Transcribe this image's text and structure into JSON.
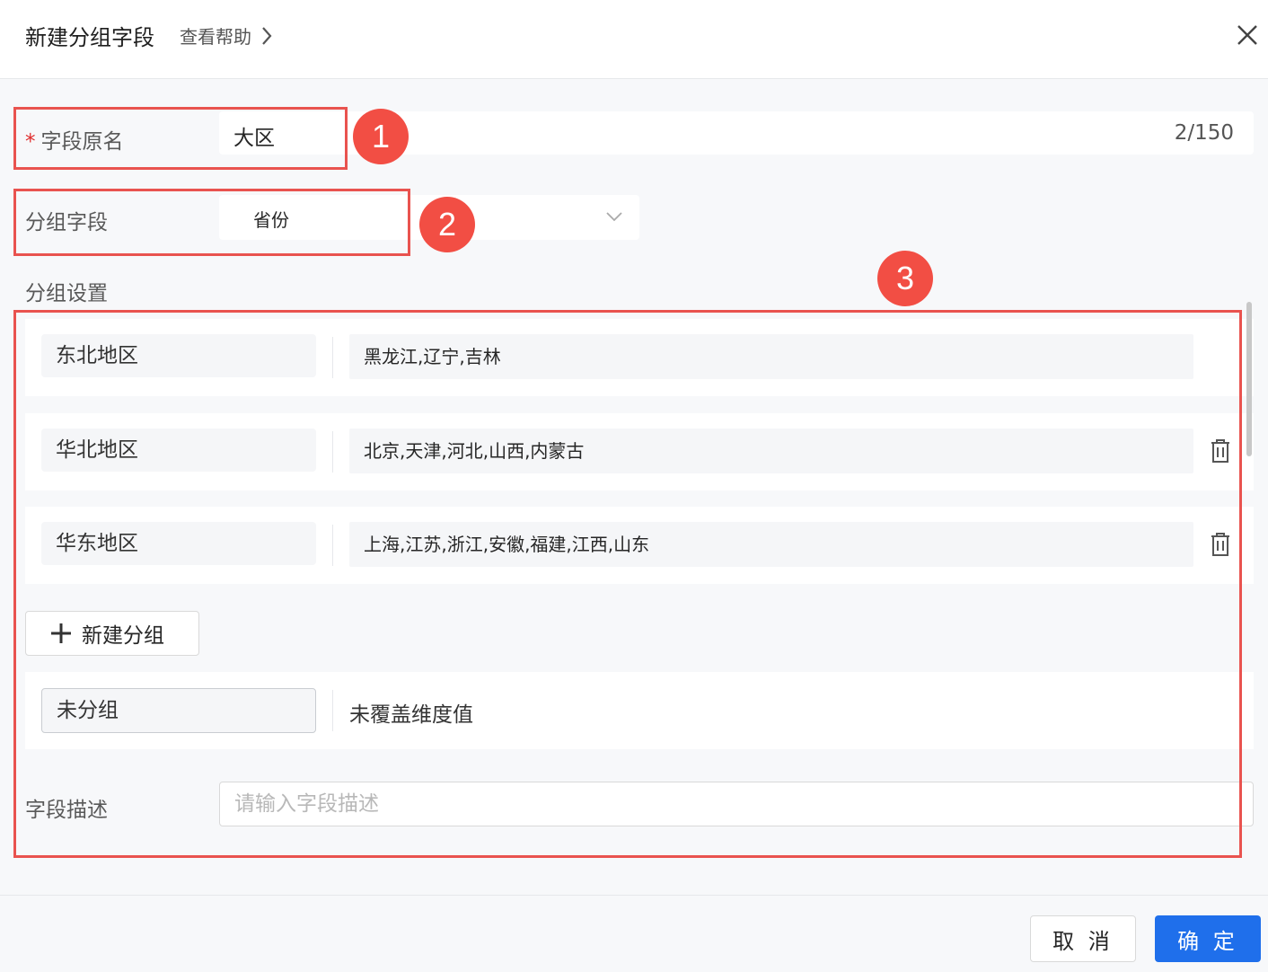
{
  "header": {
    "title": "新建分组字段",
    "help_label": "查看帮助"
  },
  "form": {
    "original_name": {
      "required_mark": "*",
      "label": "字段原名",
      "value": "大区",
      "count": "2/150"
    },
    "group_field": {
      "label": "分组字段",
      "value": "省份"
    },
    "group_settings": {
      "label": "分组设置",
      "groups": [
        {
          "name": "东北地区",
          "values": "黑龙江,辽宁,吉林"
        },
        {
          "name": "华北地区",
          "values": "北京,天津,河北,山西,内蒙古"
        },
        {
          "name": "华东地区",
          "values": "上海,江苏,浙江,安徽,福建,江西,山东"
        }
      ],
      "add_group_label": "新建分组",
      "ungrouped": {
        "name": "未分组",
        "value": "未覆盖维度值"
      }
    },
    "description": {
      "label": "字段描述",
      "placeholder": "请输入字段描述"
    }
  },
  "footer": {
    "cancel_label": "取 消",
    "ok_label": "确 定"
  },
  "annotations": [
    "1",
    "2",
    "3"
  ],
  "colors": {
    "primary": "#1f6feb",
    "annotation": "#f24e44",
    "required": "#e02e2e"
  }
}
